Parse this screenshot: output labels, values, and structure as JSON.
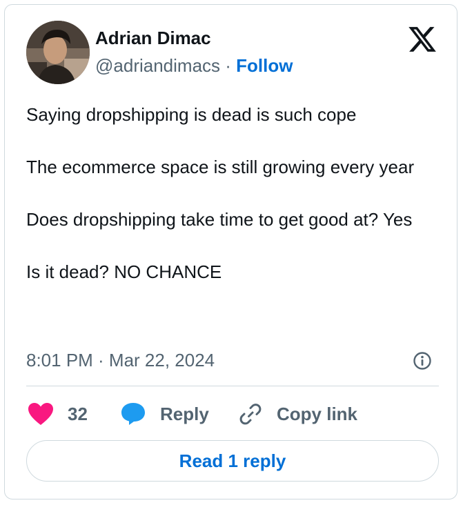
{
  "author": {
    "name": "Adrian Dimac",
    "handle": "@adriandimacs",
    "separator": "·",
    "follow_label": "Follow"
  },
  "tweet": {
    "paragraphs": [
      "Saying dropshipping is dead is such cope",
      "The ecommerce space is still growing every year",
      "Does dropshipping take time to get good at? Yes",
      "Is it dead? NO CHANCE"
    ],
    "timestamp": "8:01 PM · Mar 22, 2024"
  },
  "actions": {
    "like_count": "32",
    "reply_label": "Reply",
    "copy_link_label": "Copy link"
  },
  "read_replies_label": "Read 1 reply",
  "colors": {
    "accent": "#006fd6",
    "like": "#f91880",
    "reply": "#1d9bf0",
    "muted": "#536471",
    "border": "#cfd9de"
  },
  "icons": {
    "brand": "x-logo-icon",
    "info": "info-icon",
    "like": "heart-icon",
    "reply": "speech-bubble-icon",
    "copy": "link-icon"
  }
}
